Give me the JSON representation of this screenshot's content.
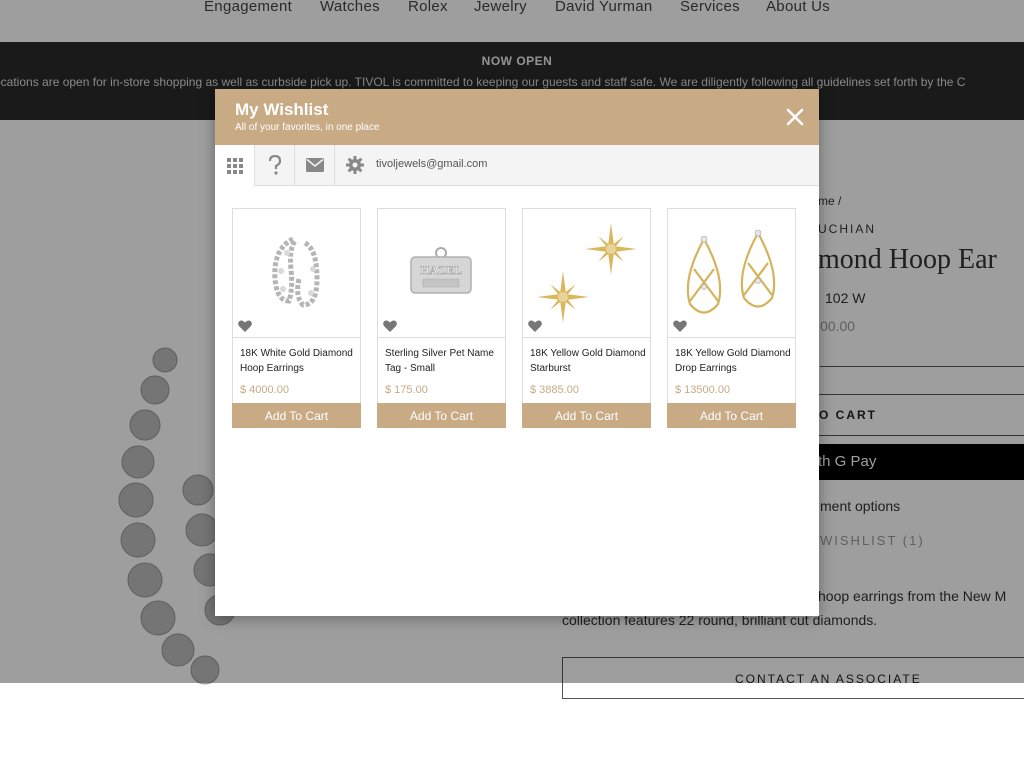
{
  "nav": {
    "items": [
      "Engagement",
      "Watches",
      "Rolex",
      "Jewelry",
      "David Yurman",
      "Services",
      "About Us"
    ]
  },
  "banner": {
    "title": "NOW OPEN",
    "text": "ocations are open for in-store shopping as well as curbside pick up. TIVOL is committed to keeping our guests and staff safe. We are diligently following all guidelines set forth by the C"
  },
  "product_bg": {
    "breadcrumb": "me /",
    "brand": "UCHIAN",
    "title": "mond Hoop Ear",
    "sku": "102 W",
    "price": "00.00",
    "add_to_cart": "O CART",
    "gpay": "th G Pay",
    "payment_options": "ment options",
    "wishlist": "WISHLIST (1)",
    "desc_line1": "hoop earrings from the New M",
    "desc_line2": "collection features 22 round, brilliant cut diamonds.",
    "contact": "CONTACT AN ASSOCIATE"
  },
  "modal": {
    "title": "My Wishlist",
    "subtitle": "All of your favorites, in one place",
    "close_icon": "close-icon",
    "email": "tivoljewels@gmail.com",
    "tools": [
      "grid-icon",
      "help-icon",
      "envelope-icon",
      "gear-icon"
    ]
  },
  "items": [
    {
      "name": "18K White Gold Diamond Hoop Earrings",
      "price": "$ 4000.00",
      "button": "Add To Cart"
    },
    {
      "name": "Sterling Silver Pet Name Tag - Small",
      "price": "$ 175.00",
      "button": "Add To Cart",
      "tag_text": "HAZEL"
    },
    {
      "name": "18K Yellow Gold Diamond Starburst",
      "price": "$ 3885.00",
      "button": "Add To Cart"
    },
    {
      "name": "18K Yellow Gold Diamond Drop Earrings",
      "price": "$ 13500.00",
      "button": "Add To Cart"
    }
  ],
  "colors": {
    "accent": "#c8aa85",
    "banner": "#2b2b2b"
  }
}
